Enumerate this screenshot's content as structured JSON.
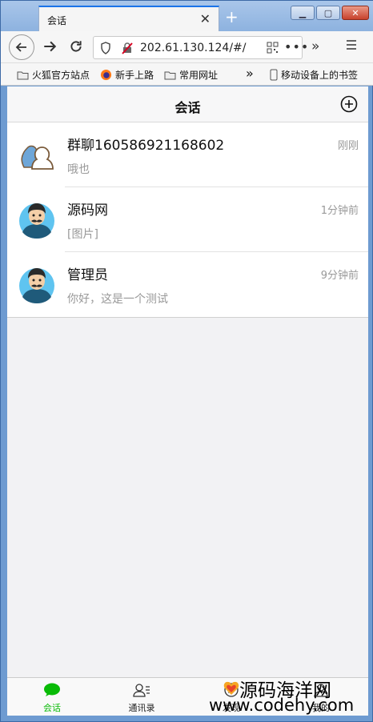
{
  "browser": {
    "tab_title": "会话",
    "url": "202.61.130.124/#/",
    "bookmarks": [
      "火狐官方站点",
      "新手上路",
      "常用网址",
      "移动设备上的书签"
    ]
  },
  "header": {
    "title": "会话"
  },
  "conversations": [
    {
      "name": "群聊160586921168602",
      "time": "刚刚",
      "preview": "哦也",
      "avatar": "group-avatar-icon"
    },
    {
      "name": "源码网",
      "time": "1分钟前",
      "preview": "[图片]",
      "avatar": "man-avatar"
    },
    {
      "name": "管理员",
      "time": "9分钟前",
      "preview": "你好，这是一个测试",
      "avatar": "man-avatar"
    }
  ],
  "tabbar": [
    {
      "label": "会话",
      "icon": "chat-bubble-icon",
      "active": true
    },
    {
      "label": "通讯录",
      "icon": "contacts-icon",
      "active": false
    },
    {
      "label": "发现",
      "icon": "discover-icon",
      "active": false
    },
    {
      "label": "我的",
      "icon": "profile-icon",
      "active": false
    }
  ],
  "watermark": {
    "line1": "源码海洋网",
    "line2": "www.codehy.com"
  },
  "colors": {
    "accent_green": "#09bb07",
    "avatar_bg": "#5fc4f0"
  }
}
